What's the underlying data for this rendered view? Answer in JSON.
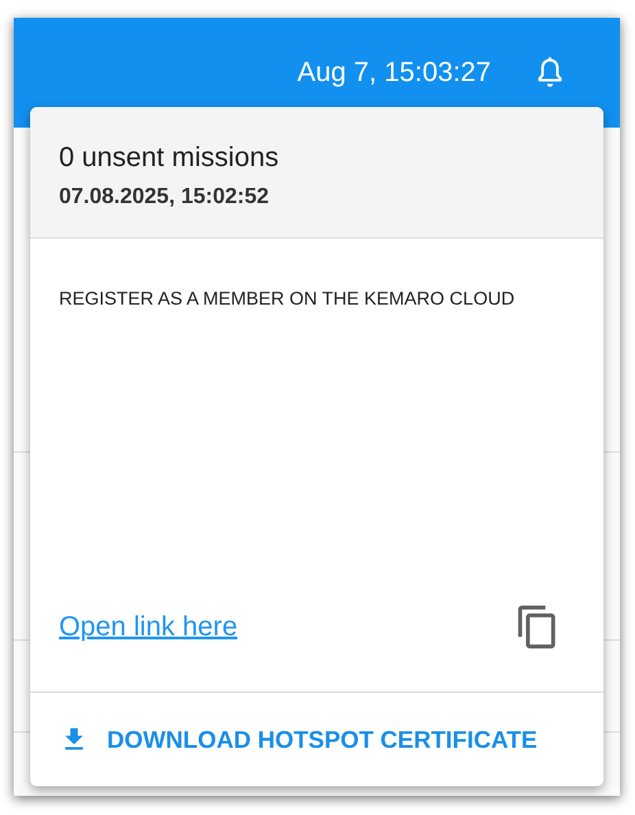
{
  "header": {
    "datetime": "Aug 7, 15:03:27"
  },
  "popup": {
    "unsent": "0 unsent missions",
    "timestamp": "07.08.2025, 15:02:52",
    "message": "REGISTER AS A MEMBER ON THE KEMARO CLOUD",
    "link": "Open link here",
    "download": "DOWNLOAD HOTSPOT CERTIFICATE"
  }
}
